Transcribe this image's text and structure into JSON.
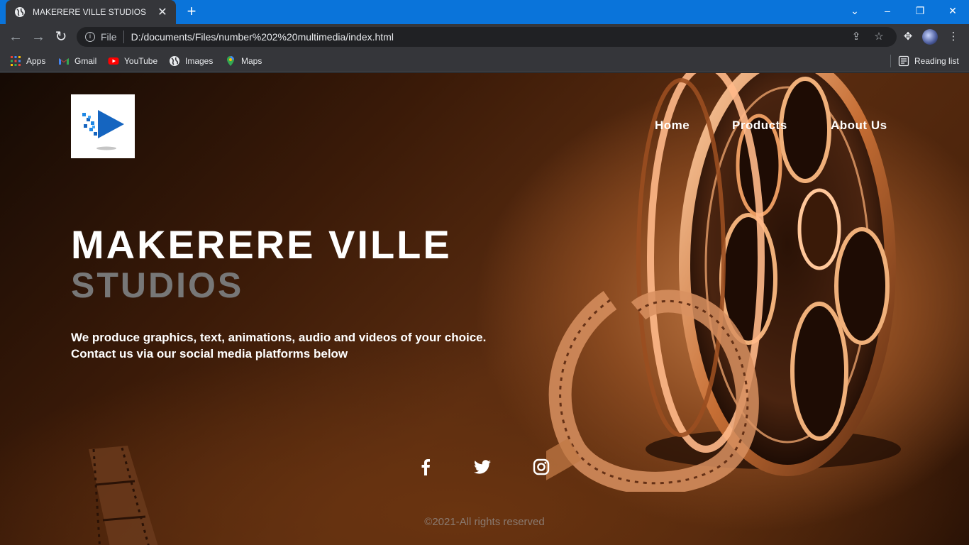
{
  "browser": {
    "tab_title": "MAKERERE VILLE STUDIOS",
    "tab_close": "✕",
    "new_tab": "+",
    "scheme": "File",
    "url": "D:/documents/Files/number%202%20multimedia/index.html",
    "window_controls": {
      "dropdown": "⌄",
      "minimize": "–",
      "restore": "❐",
      "close": "✕"
    }
  },
  "bookmarks": {
    "items": [
      {
        "label": "Apps",
        "icon": "apps-grid-icon"
      },
      {
        "label": "Gmail",
        "icon": "gmail-icon"
      },
      {
        "label": "YouTube",
        "icon": "youtube-icon"
      },
      {
        "label": "Images",
        "icon": "globe-icon"
      },
      {
        "label": "Maps",
        "icon": "maps-pin-icon"
      }
    ],
    "reading_list": "Reading list"
  },
  "site": {
    "nav": {
      "home": "Home",
      "products": "Products",
      "about": "About Us"
    },
    "hero": {
      "title": "MAKERERE VILLE",
      "subtitle": "STUDIOS",
      "line1": "We produce graphics, text, animations, audio and videos of your choice.",
      "line2": "Contact us via our social media platforms below"
    },
    "social": [
      "facebook-icon",
      "twitter-icon",
      "instagram-icon"
    ],
    "copyright": "©2021-All rights reserved"
  },
  "colors": {
    "titlebar": "#0a74da",
    "chrome": "#35363a",
    "subtitle_gray": "#777777",
    "logo_blue": "#1565c0"
  }
}
